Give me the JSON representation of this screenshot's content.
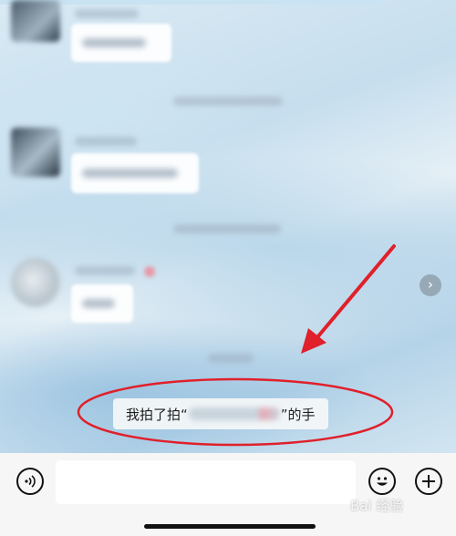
{
  "chat": {
    "system_message": {
      "prefix": "我拍了拍“",
      "suffix": "”的手"
    }
  },
  "composer": {
    "input_value": "",
    "placeholder": "",
    "voice_icon": "voice-icon",
    "emoji_icon": "emoji-icon",
    "plus_icon": "plus-icon"
  },
  "watermark": {
    "text": "Bai 经验"
  },
  "colors": {
    "annotation_red": "#e0202a",
    "input_bar_bg": "#f6f6f6"
  }
}
